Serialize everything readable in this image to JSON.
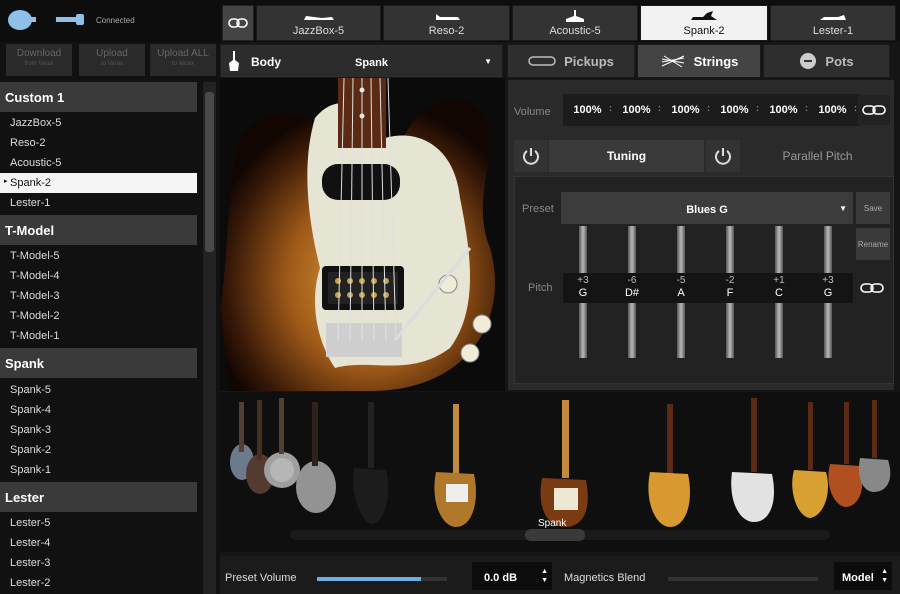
{
  "app": {
    "status": "Connected"
  },
  "left": {
    "buttons": [
      {
        "label": "Download",
        "sub": "from Varax"
      },
      {
        "label": "Upload",
        "sub": "to Varax"
      },
      {
        "label": "Upload ALL",
        "sub": "to Varax"
      }
    ],
    "groups": [
      {
        "name": "Custom 1",
        "items": [
          "JazzBox-5",
          "Reso-2",
          "Acoustic-5",
          "Spank-2",
          "Lester-1"
        ]
      },
      {
        "name": "T-Model",
        "items": [
          "T-Model-5",
          "T-Model-4",
          "T-Model-3",
          "T-Model-2",
          "T-Model-1"
        ]
      },
      {
        "name": "Spank",
        "items": [
          "Spank-5",
          "Spank-4",
          "Spank-3",
          "Spank-2",
          "Spank-1"
        ]
      },
      {
        "name": "Lester",
        "items": [
          "Lester-5",
          "Lester-4",
          "Lester-3",
          "Lester-2"
        ]
      }
    ],
    "selected": "Spank-2"
  },
  "top_tabs": [
    "JazzBox-5",
    "Reso-2",
    "Acoustic-5",
    "Spank-2",
    "Lester-1"
  ],
  "active_top_tab": 3,
  "body": {
    "label": "Body",
    "value": "Spank"
  },
  "right_tabs": [
    "Pickups",
    "Strings",
    "Pots"
  ],
  "active_right_tab": 1,
  "strings": {
    "volume_label": "Volume",
    "volumes": [
      "100%",
      "100%",
      "100%",
      "100%",
      "100%",
      "100%"
    ],
    "tuning_tab": "Tuning",
    "parallel_tab": "Parallel Pitch",
    "preset_label": "Preset",
    "preset_value": "Blues G",
    "save_label": "Save",
    "rename_label": "Rename",
    "pitch_label": "Pitch",
    "pitch": [
      {
        "offset": "+3",
        "note": "G"
      },
      {
        "offset": "-6",
        "note": "D#"
      },
      {
        "offset": "-5",
        "note": "A"
      },
      {
        "offset": "-2",
        "note": "F"
      },
      {
        "offset": "+1",
        "note": "C"
      },
      {
        "offset": "+3",
        "note": "G"
      }
    ]
  },
  "selector": {
    "caption": "Spank"
  },
  "footer": {
    "preset_volume_label": "Preset Volume",
    "preset_volume_level": 0.8,
    "db_value": "0.0 dB",
    "blend_label": "Magnetics Blend",
    "blend_level": 0.0,
    "model_value": "Model"
  },
  "colors": {
    "accent": "#6ab0e0",
    "selected": "#f5f5f5",
    "panel": "#2a2a2a"
  }
}
